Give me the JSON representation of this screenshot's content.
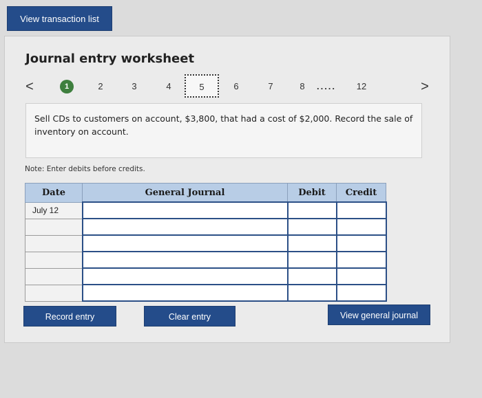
{
  "top_button": {
    "label": "View transaction list"
  },
  "worksheet": {
    "title": "Journal entry worksheet",
    "pager": {
      "prev": "<",
      "next": ">",
      "items": [
        "1",
        "2",
        "3",
        "4",
        "5",
        "6",
        "7",
        "8",
        ".....",
        "12"
      ],
      "active": "1",
      "boxed": "5"
    },
    "description": "Sell CDs to customers on account, $3,800, that had a cost of $2,000. Record the sale of inventory on account.",
    "note": "Note: Enter debits before credits.",
    "table": {
      "headers": [
        "Date",
        "General Journal",
        "Debit",
        "Credit"
      ],
      "rows": [
        [
          "July 12",
          "",
          "",
          ""
        ],
        [
          "",
          "",
          "",
          ""
        ],
        [
          "",
          "",
          "",
          ""
        ],
        [
          "",
          "",
          "",
          ""
        ],
        [
          "",
          "",
          "",
          ""
        ],
        [
          "",
          "",
          "",
          ""
        ]
      ]
    },
    "buttons": {
      "record": "Record entry",
      "clear": "Clear entry",
      "view_journal": "View general journal"
    }
  },
  "colors": {
    "button_bg": "#244c8a",
    "header_bg": "#b8cde6",
    "active_step": "#3e7f3e"
  }
}
